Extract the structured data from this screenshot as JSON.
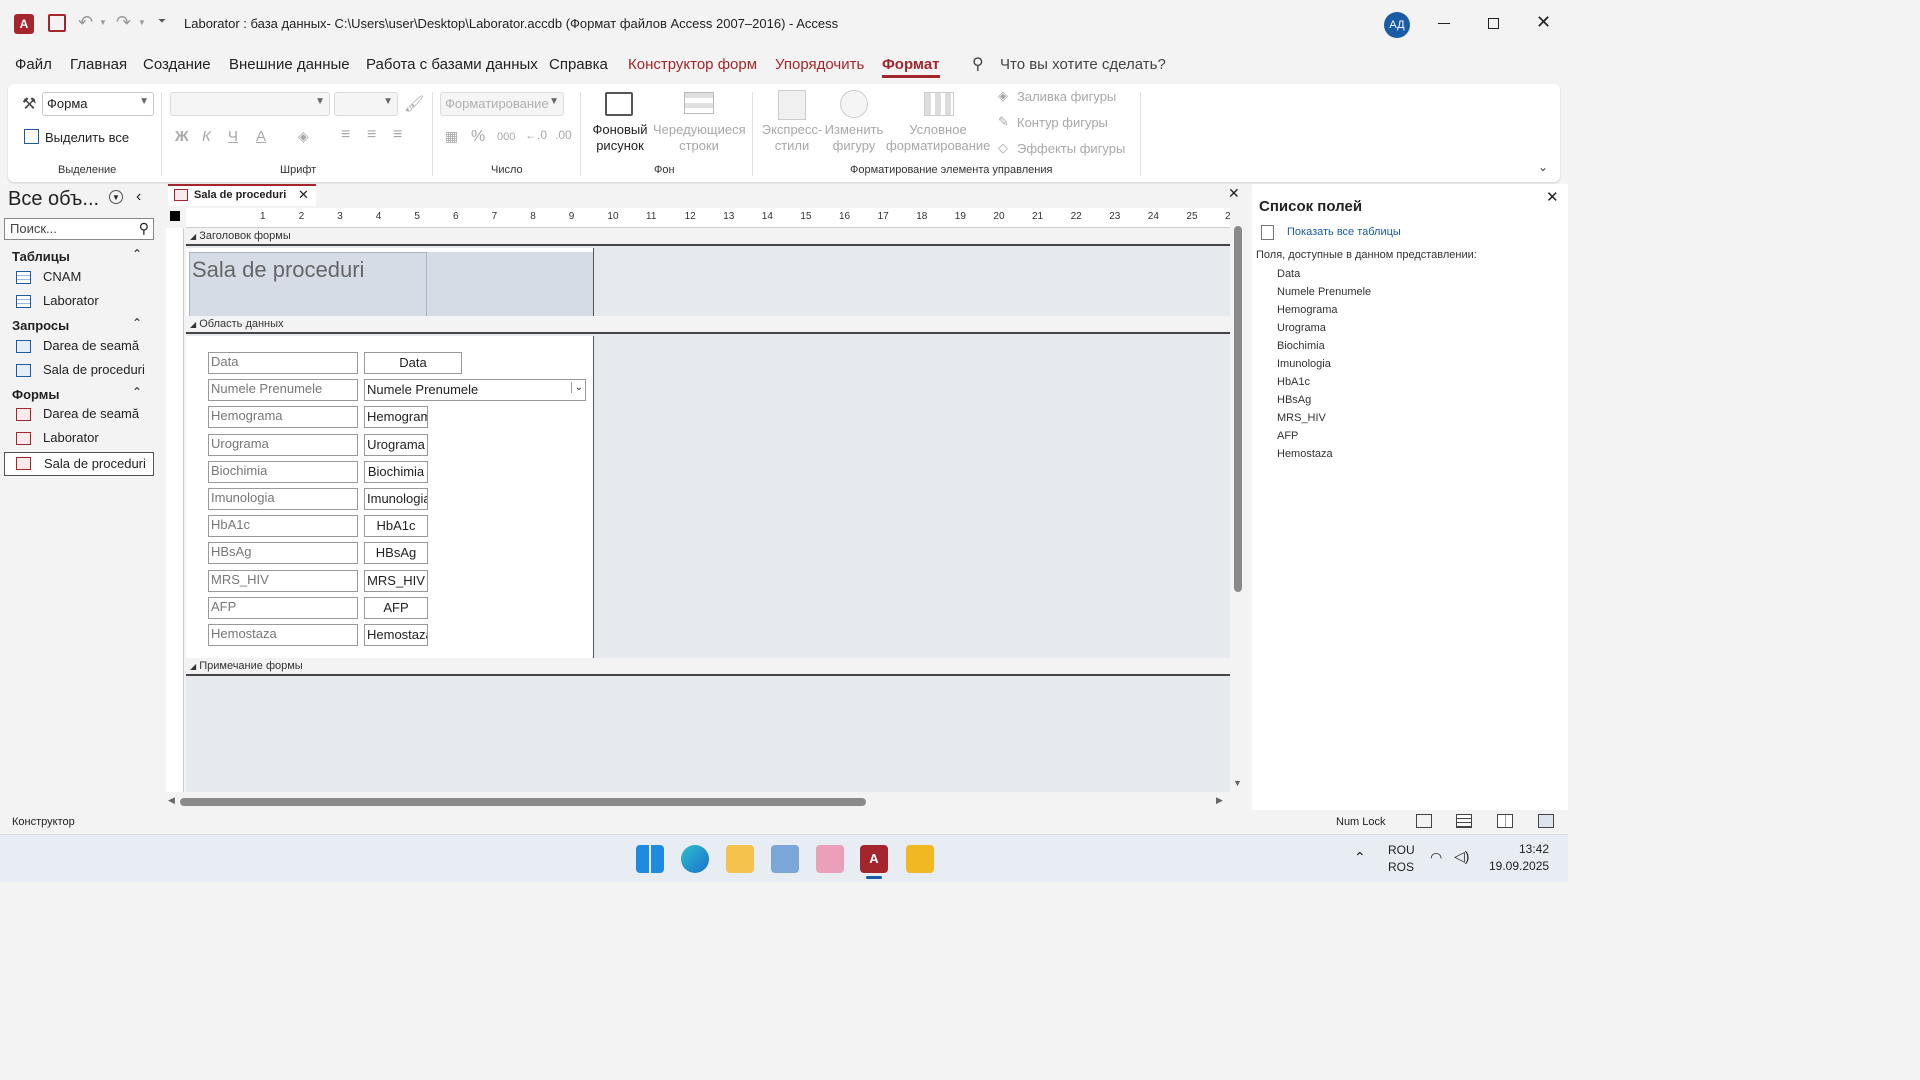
{
  "titlebar": {
    "title": "Laborator : база данных- C:\\Users\\user\\Desktop\\Laborator.accdb (Формат файлов Access 2007–2016)  -  Access",
    "user_initials": "АД"
  },
  "menu": [
    "Файл",
    "Главная",
    "Создание",
    "Внешние данные",
    "Работа с базами данных",
    "Справка",
    "Конструктор форм",
    "Упорядочить",
    "Формат"
  ],
  "search_tell_me": "Что вы хотите сделать?",
  "ribbon": {
    "selection": {
      "object_combo": "Форма",
      "select_all": "Выделить все",
      "label": "Выделение"
    },
    "font": {
      "label": "Шрифт",
      "bold": "Ж",
      "italic": "К",
      "underline": "Ч",
      "font_color": "А"
    },
    "number": {
      "format_combo": "Форматирование",
      "label": "Число",
      "percent": "%",
      "thousands": "000"
    },
    "background": {
      "bg_picture": "Фоновый рисунок",
      "alt_rows": "Чередующиеся строки",
      "label": "Фон"
    },
    "control_formatting": {
      "quick_styles": "Экспресс-стили",
      "change_shape": "Изменить фигуру",
      "conditional": "Условное форматирование",
      "shape_fill": "Заливка фигуры",
      "shape_outline": "Контур фигуры",
      "shape_effects": "Эффекты фигуры",
      "label": "Форматирование элемента управления"
    }
  },
  "nav": {
    "title": "Все объ...",
    "search_placeholder": "Поиск...",
    "groups": [
      {
        "name": "Таблицы",
        "items": [
          "CNAM",
          "Laborator"
        ]
      },
      {
        "name": "Запросы",
        "items": [
          "Darea de seamă",
          "Sala de proceduri"
        ]
      },
      {
        "name": "Формы",
        "items": [
          "Darea de seamă",
          "Laborator",
          "Sala de proceduri"
        ]
      }
    ]
  },
  "document_tab": "Sala de proceduri",
  "ruler_numbers": [
    "1",
    "2",
    "3",
    "4",
    "5",
    "6",
    "7",
    "8",
    "9",
    "10",
    "11",
    "12",
    "13",
    "14",
    "15",
    "16",
    "17",
    "18",
    "19",
    "20",
    "21",
    "22",
    "23",
    "24",
    "25",
    "26",
    "2"
  ],
  "form": {
    "header_band": "Заголовок формы",
    "title": "Sala de proceduri",
    "detail_band": "Область данных",
    "footer_band": "Примечание формы",
    "labels": [
      "Data",
      "Numele Prenumele",
      "Hemograma",
      "Urograma",
      "Biochimia",
      "Imunologia",
      "HbA1c",
      "HBsAg",
      "MRS_HIV",
      "AFP",
      "Hemostaza"
    ],
    "fields": [
      "Data",
      "Numele Prenumele",
      "Hemogram.",
      "Urograma",
      "Biochimia",
      "Imunologia",
      "HbA1c",
      "HBsAg",
      "MRS_HIV",
      "AFP",
      "Hemostaza"
    ]
  },
  "field_list": {
    "title": "Список полей",
    "show_all": "Показать все таблицы",
    "available_caption": "Поля, доступные в данном представлении:",
    "fields": [
      "Data",
      "Numele Prenumele",
      "Hemograma",
      "Urograma",
      "Biochimia",
      "Imunologia",
      "HbA1c",
      "HBsAg",
      "MRS_HIV",
      "AFP",
      "Hemostaza"
    ]
  },
  "status": {
    "mode": "Конструктор",
    "num_lock": "Num Lock"
  },
  "taskbar": {
    "lang1": "ROU",
    "lang2": "ROS",
    "time": "13:42",
    "date": "19.09.2025"
  },
  "colors": {
    "access_red": "#a4262c",
    "avatar_blue": "#1a5ba6"
  }
}
